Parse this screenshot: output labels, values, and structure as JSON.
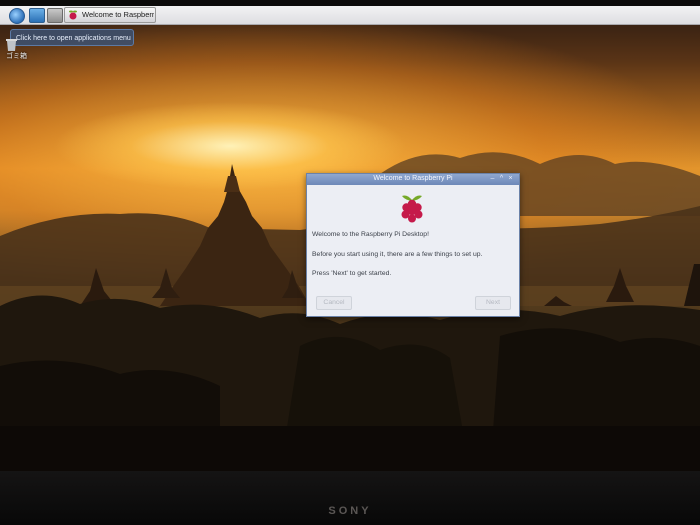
{
  "taskbar": {
    "task_window_label": "Welcome to Raspberr"
  },
  "tooltip": {
    "text": "Click here to open applications menu"
  },
  "desktop": {
    "trash_label": "ゴミ箱"
  },
  "dialog": {
    "title": "Welcome to Raspberry Pi",
    "controls": {
      "minimize": "–",
      "maximize": "^",
      "close": "×"
    },
    "welcome": "Welcome to the Raspberry Pi Desktop!",
    "setup": "Before you start using it, there are a few things to set up.",
    "hint": "Press 'Next' to get started.",
    "cancel_label": "Cancel",
    "next_label": "Next"
  },
  "monitor": {
    "brand": "SONY"
  },
  "colors": {
    "sky_glow": "#e3952c",
    "titlebar": "#7a93c2",
    "raspberry_red": "#c51a4a",
    "leaf_green": "#75a928"
  }
}
